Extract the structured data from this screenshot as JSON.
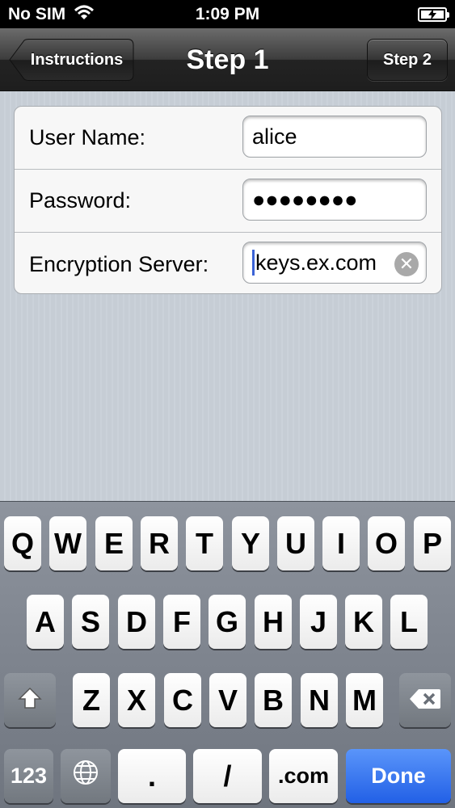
{
  "status_bar": {
    "carrier": "No SIM",
    "time": "1:09 PM",
    "wifi_icon": "wifi-icon",
    "battery_icon": "battery-charging-icon"
  },
  "nav": {
    "title": "Step 1",
    "back_label": "Instructions",
    "next_label": "Step 2"
  },
  "form": {
    "username_label": "User Name:",
    "username_value": "alice",
    "password_label": "Password:",
    "password_value": "●●●●●●●●",
    "server_label": "Encryption Server:",
    "server_value": "keys.ex.com",
    "clear_icon": "clear-icon"
  },
  "keyboard": {
    "row1": [
      "Q",
      "W",
      "E",
      "R",
      "T",
      "Y",
      "U",
      "I",
      "O",
      "P"
    ],
    "row2": [
      "A",
      "S",
      "D",
      "F",
      "G",
      "H",
      "J",
      "K",
      "L"
    ],
    "row3": [
      "Z",
      "X",
      "C",
      "V",
      "B",
      "N",
      "M"
    ],
    "numbers_label": "123",
    "dot_label": ".",
    "slash_label": "/",
    "dotcom_label": ".com",
    "done_label": "Done",
    "accent_color": "#2a66e8"
  }
}
